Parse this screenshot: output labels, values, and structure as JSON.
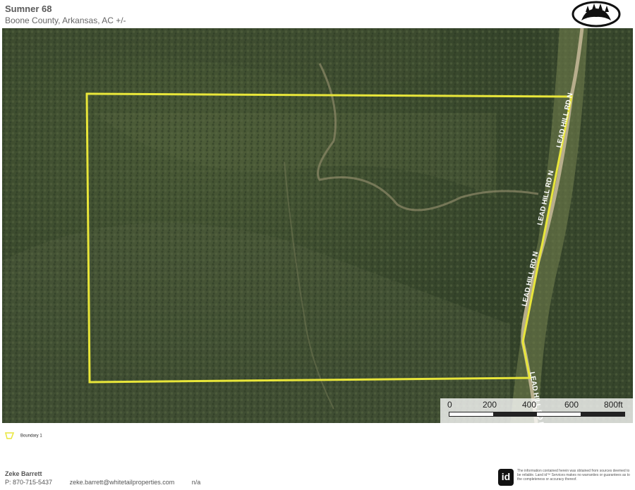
{
  "header": {
    "title": "Sumner 68",
    "subtitle": "Boone County, Arkansas,  AC +/-",
    "logo_icon": "bear-paw-icon"
  },
  "map": {
    "boundary_color": "#e8e63a",
    "road_labels": [
      "LEAD HILL RD N",
      "LEAD HILL RD N",
      "LEAD HILL RD N",
      "LEAD HILL RD N"
    ],
    "scale": {
      "labels": [
        "0",
        "200",
        "400",
        "600",
        "800ft"
      ]
    }
  },
  "legend": {
    "items": [
      {
        "icon": "boundary-swatch-icon",
        "label": "Boundary 1",
        "color": "#e8e63a"
      }
    ]
  },
  "footer": {
    "agent_name": "Zeke Barrett",
    "phone": "P: 870-715-5437",
    "email": "zeke.barrett@whitetailproperties.com",
    "other": "n/a",
    "brand_icon_text": "id",
    "disclaimer": "The information contained herein was obtained from sources deemed to be reliable. Land id™ Services makes no warranties or guarantees as to the completeness or accuracy thereof."
  }
}
